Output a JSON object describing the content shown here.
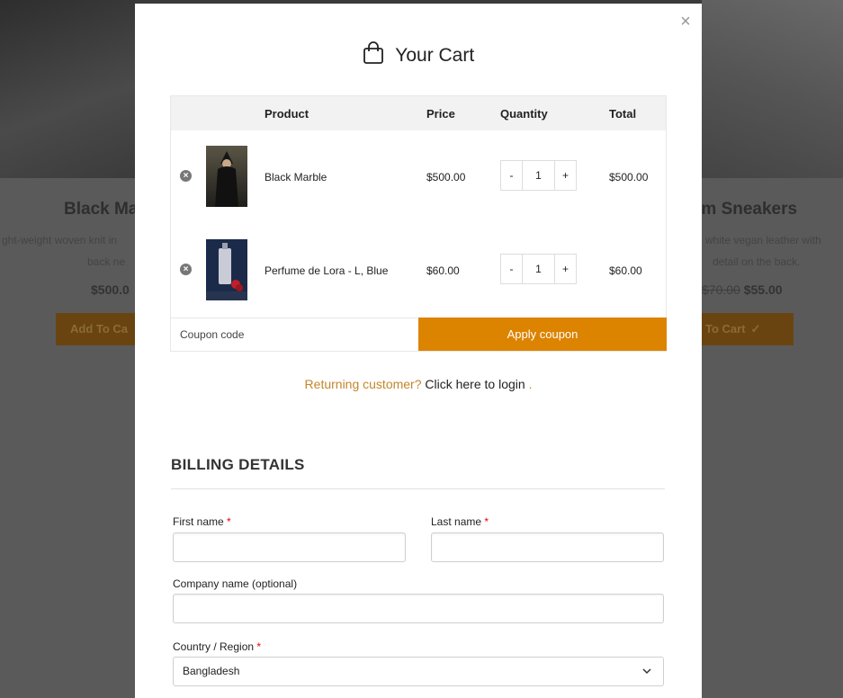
{
  "background": {
    "cards": [
      {
        "title": "Black Ma",
        "desc1": "ght-weight woven knit in",
        "desc2": "back ne",
        "price": "$500.0",
        "button": "Add To Ca"
      },
      {
        "title": "rm Sneakers",
        "desc1": "white vegan leather with",
        "desc2": "detail on the back.",
        "price_old": "$70.00",
        "price": "$55.00",
        "button": "To Cart",
        "check": "✓"
      }
    ]
  },
  "modal": {
    "close_icon": "×",
    "title": "Your Cart",
    "table": {
      "headers": {
        "product": "Product",
        "price": "Price",
        "quantity": "Quantity",
        "total": "Total"
      },
      "rows": [
        {
          "name": "Black Marble",
          "price": "$500.00",
          "qty": "1",
          "total": "$500.00",
          "thumb_color": "#2b2a24"
        },
        {
          "name": "Perfume de Lora - L, Blue",
          "price": "$60.00",
          "qty": "1",
          "total": "$60.00",
          "thumb_color": "#1c2a4a"
        }
      ],
      "minus": "-",
      "plus": "+"
    },
    "coupon": {
      "placeholder": "Coupon code",
      "apply_label": "Apply coupon"
    },
    "returning": {
      "question": "Returning customer?",
      "link": "Click here to login",
      "dot": "."
    },
    "billing": {
      "title": "BILLING DETAILS",
      "first_name_label": "First name",
      "last_name_label": "Last name",
      "company_label": "Company name (optional)",
      "country_label": "Country / Region",
      "country_value": "Bangladesh",
      "required_mark": "*"
    }
  },
  "colors": {
    "accent": "#dc8300",
    "link_accent": "#c4862a"
  }
}
